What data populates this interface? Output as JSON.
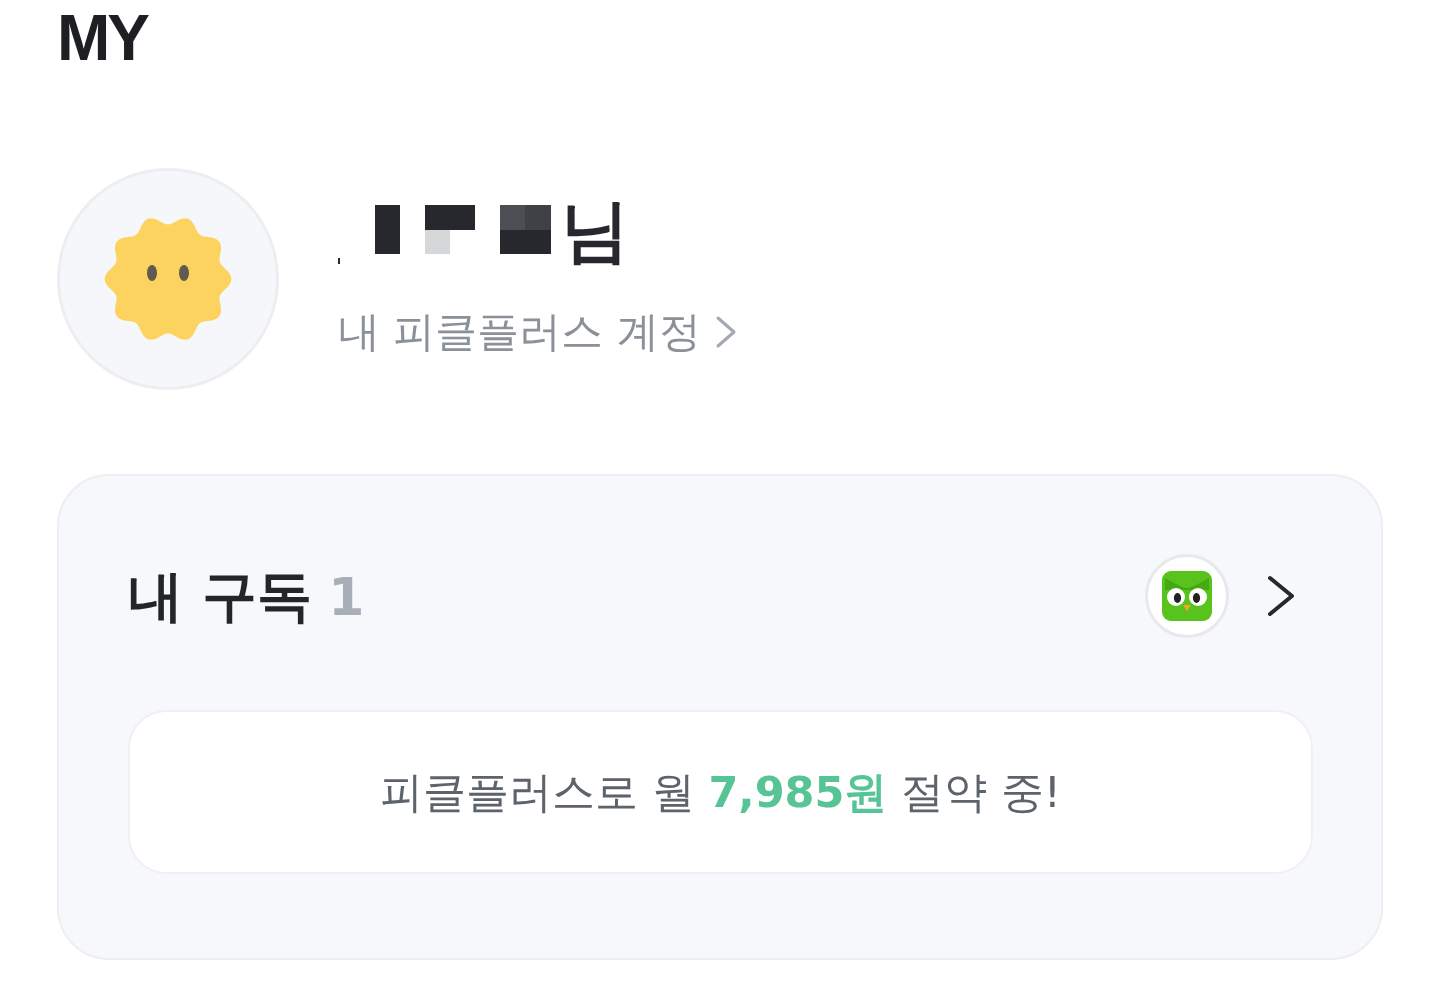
{
  "page": {
    "title": "MY"
  },
  "profile": {
    "name_redacted": true,
    "name": "님",
    "account_link": "내 피클플러스 계정"
  },
  "subscriptions": {
    "title": "내 구독",
    "count": "1",
    "savings": "피클플러스로 월 **7,985원** 절약 중!"
  }
}
